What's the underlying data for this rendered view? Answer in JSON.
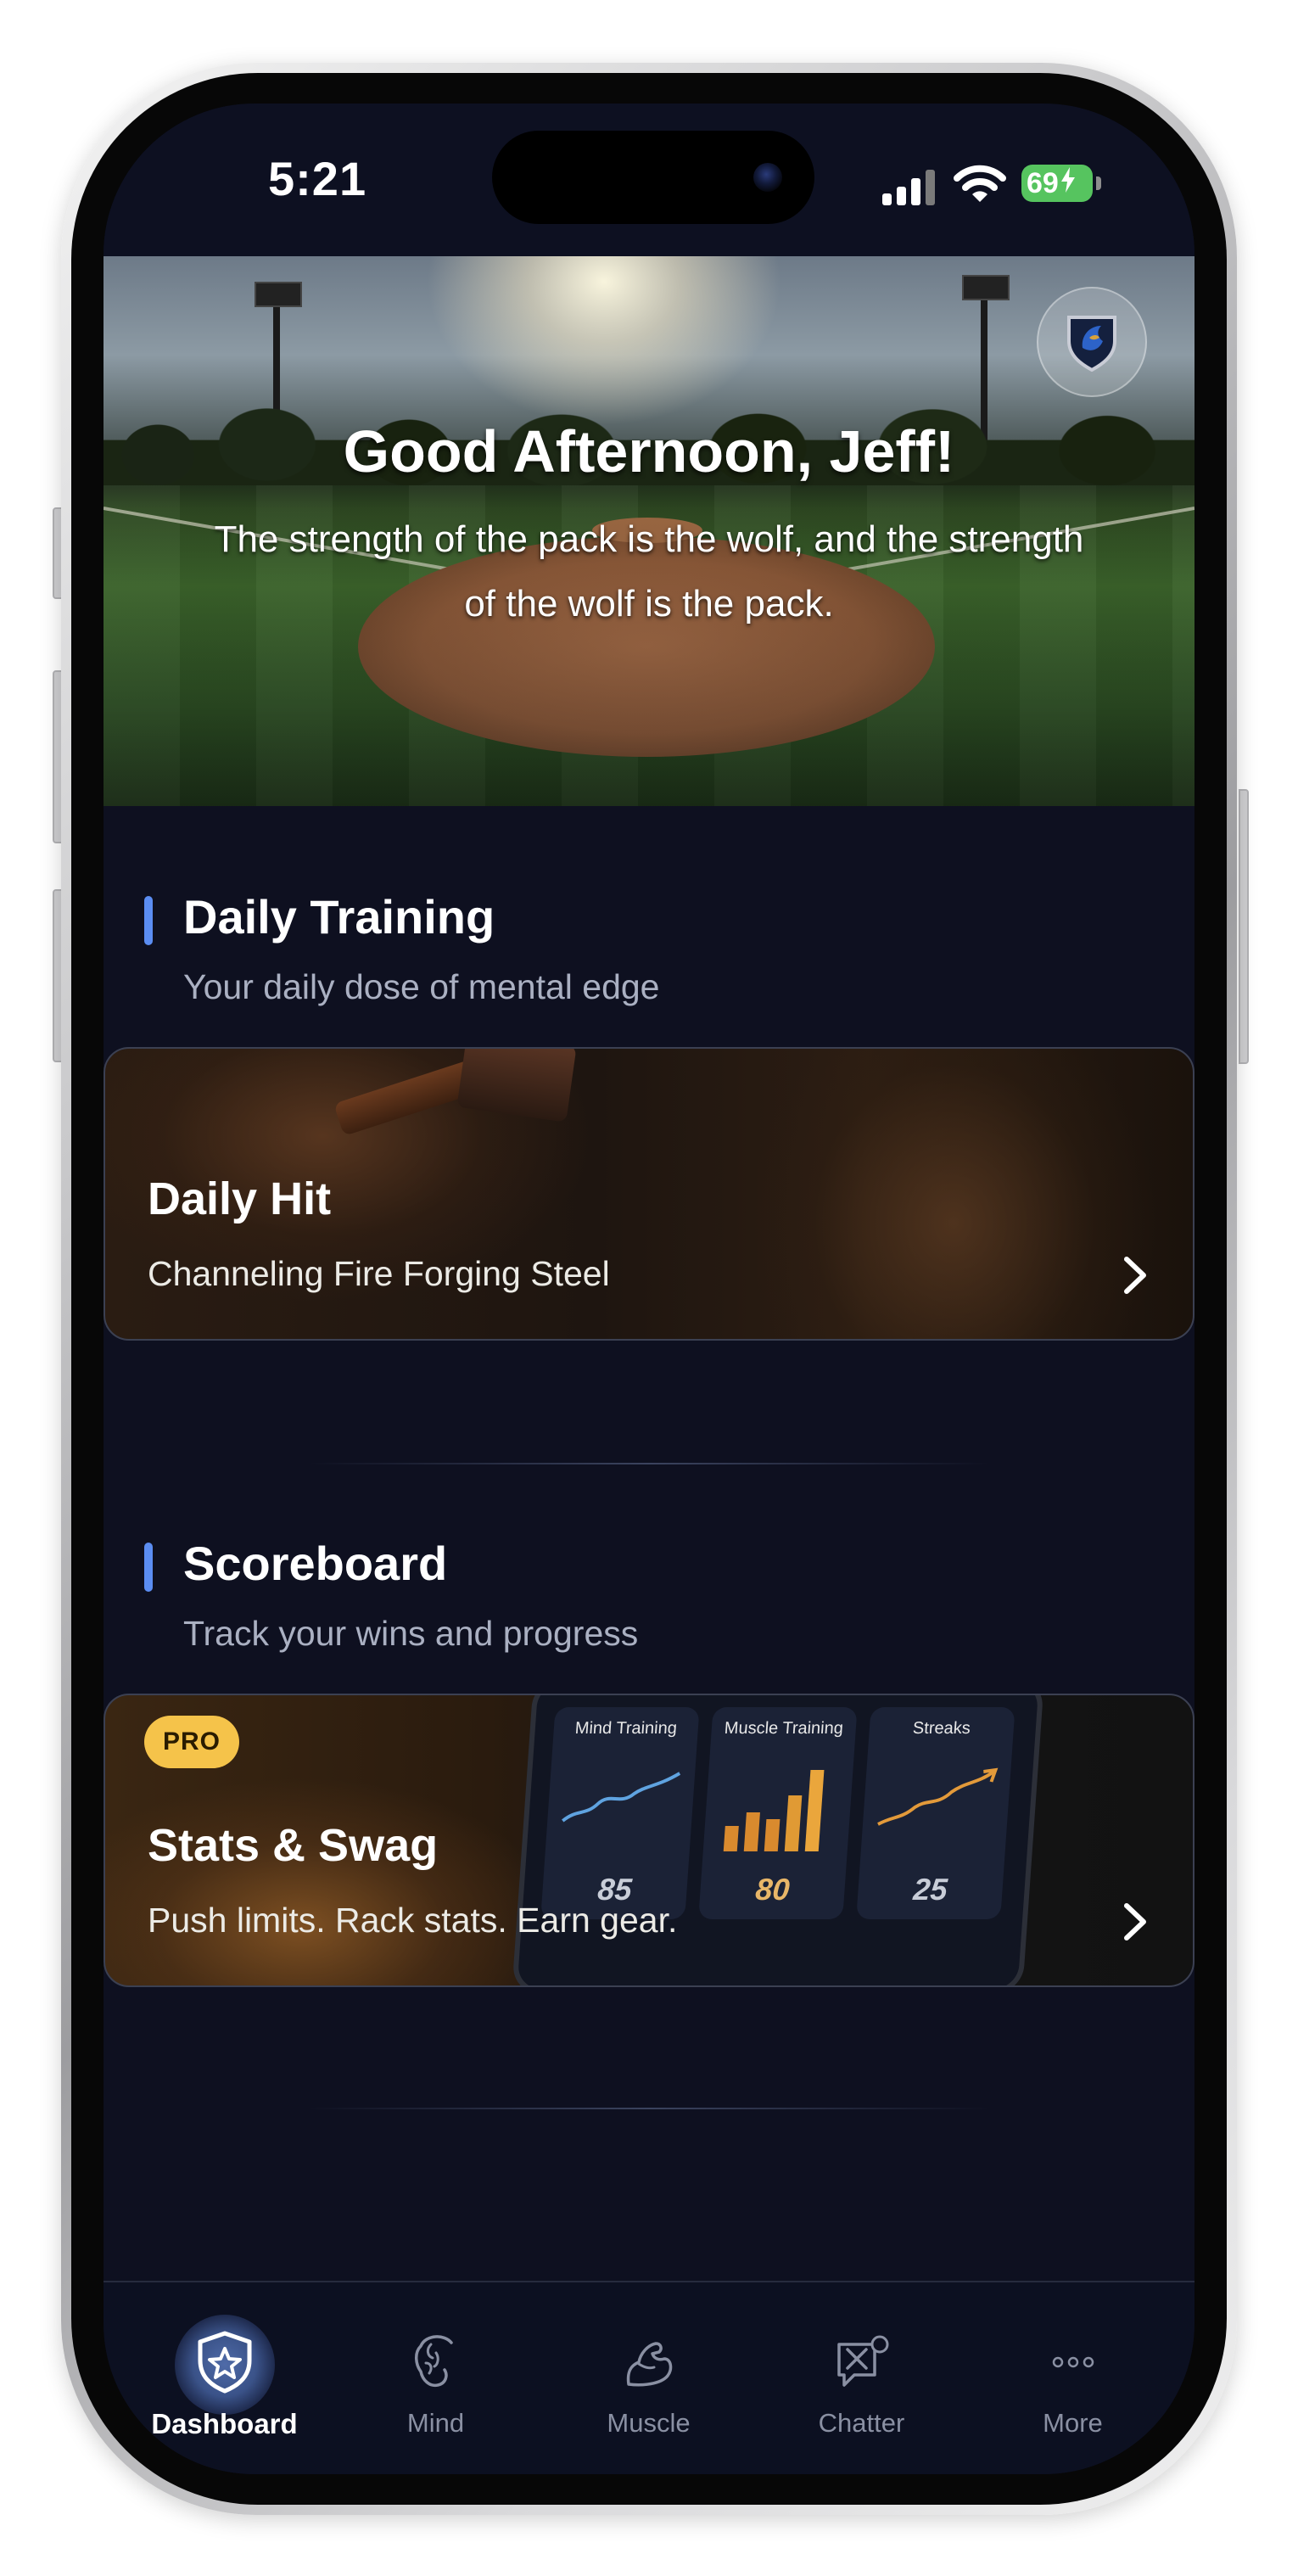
{
  "status_bar": {
    "time": "5:21",
    "battery": "69"
  },
  "hero": {
    "greeting": "Good Afternoon, Jeff!",
    "quote": "The strength of the pack is the wolf, and the strength of the wolf is the pack."
  },
  "daily_training": {
    "title": "Daily Training",
    "subtitle": "Your daily dose of mental edge",
    "card": {
      "title": "Daily Hit",
      "subtitle": "Channeling Fire  Forging Steel"
    }
  },
  "scoreboard": {
    "title": "Scoreboard",
    "subtitle": "Track your wins and progress",
    "card": {
      "badge": "PRO",
      "title": "Stats & Swag",
      "subtitle": "Push limits. Rack stats. Earn gear.",
      "panels": [
        {
          "label": "Mind Training",
          "value": "85"
        },
        {
          "label": "Muscle Training",
          "value": "80"
        },
        {
          "label": "Streaks",
          "value": "25"
        }
      ]
    }
  },
  "tabs": [
    {
      "label": "Dashboard",
      "icon": "shield-star-icon",
      "active": true
    },
    {
      "label": "Mind",
      "icon": "brain-icon",
      "active": false
    },
    {
      "label": "Muscle",
      "icon": "flexed-arm-icon",
      "active": false
    },
    {
      "label": "Chatter",
      "icon": "chat-bat-icon",
      "active": false
    },
    {
      "label": "More",
      "icon": "more-dots-icon",
      "active": false
    }
  ],
  "colors": {
    "accent": "#5b8df2",
    "background": "#0e1020",
    "pro": "#f5c34a"
  }
}
